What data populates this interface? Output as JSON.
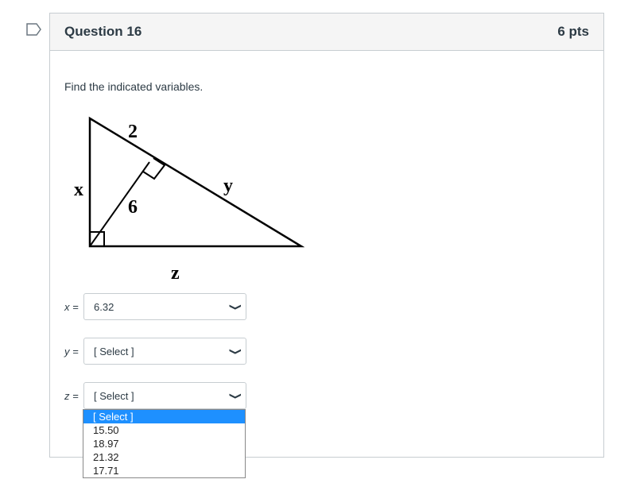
{
  "question": {
    "title": "Question 16",
    "points": "6 pts",
    "prompt": "Find the indicated variables."
  },
  "figure": {
    "labels": {
      "top": "2",
      "x": "x",
      "altitude": "6",
      "y": "y",
      "z": "z"
    }
  },
  "answers": [
    {
      "label": "x =",
      "value": "6.32"
    },
    {
      "label": "y =",
      "value": "[ Select ]"
    },
    {
      "label": "z =",
      "value": "[ Select ]"
    }
  ],
  "dropdown": {
    "options": [
      "[ Select ]",
      "15.50",
      "18.97",
      "21.32",
      "17.71"
    ],
    "highlighted": "[ Select ]"
  },
  "colors": {
    "highlight": "#1e90ff"
  },
  "icons": {
    "flag": "bookmark-flag-icon",
    "chevron": "chevron-down-icon"
  }
}
